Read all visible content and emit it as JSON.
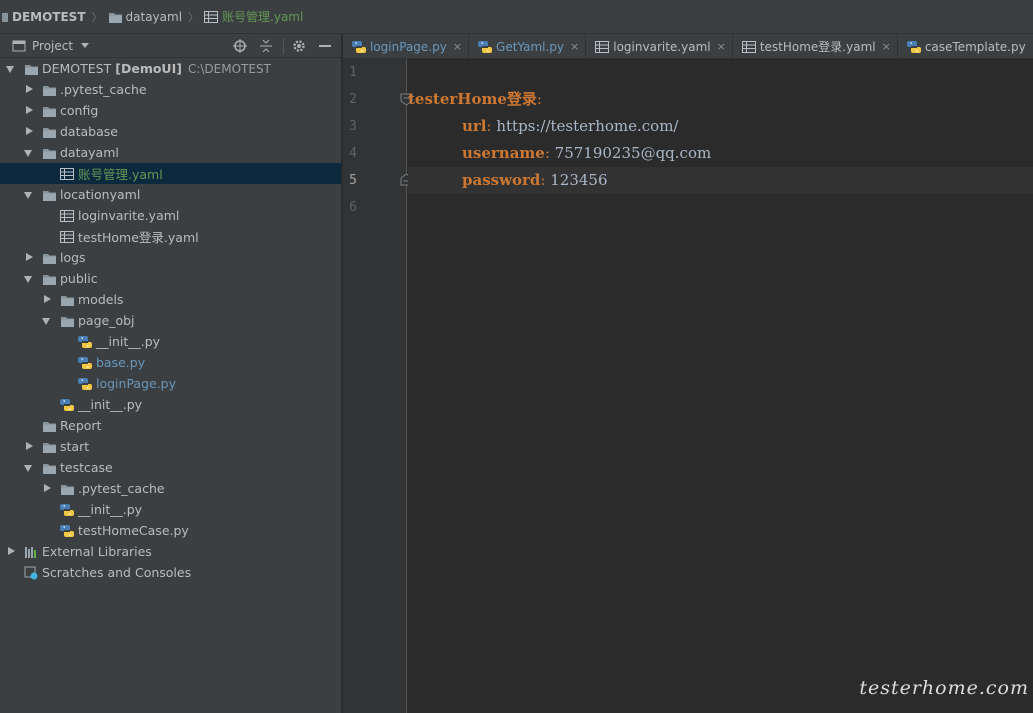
{
  "breadcrumb": {
    "project": "DEMOTEST",
    "folder": "datayaml",
    "file": "账号管理.yaml"
  },
  "project_panel": {
    "view_label": "Project",
    "tools": [
      "locate-icon",
      "collapse-icon",
      "gear-icon",
      "hide-icon"
    ]
  },
  "tree": {
    "root_name": "DEMOTEST",
    "root_module": "[DemoUI]",
    "root_path": "C:\\DEMOTEST",
    "pytest_cache": ".pytest_cache",
    "config": "config",
    "database": "database",
    "datayaml": "datayaml",
    "account_yaml": "账号管理.yaml",
    "locationyaml": "locationyaml",
    "loginvarite_yaml": "loginvarite.yaml",
    "testhome_yaml": "testHome登录.yaml",
    "logs": "logs",
    "public": "public",
    "models": "models",
    "page_obj": "page_obj",
    "init_py_1": "__init__.py",
    "base_py": "base.py",
    "loginpage_py": "loginPage.py",
    "init_py_2": "__init__.py",
    "report": "Report",
    "start": "start",
    "testcase": "testcase",
    "pytest_cache_2": ".pytest_cache",
    "init_py_3": "__init__.py",
    "testhomecase_py": "testHomeCase.py",
    "external_libraries": "External Libraries",
    "scratches": "Scratches and Consoles"
  },
  "tabs": [
    {
      "label": "loginPage.py",
      "close": "×"
    },
    {
      "label": "GetYaml.py",
      "close": "×"
    },
    {
      "label": "loginvarite.yaml",
      "close": "×"
    },
    {
      "label": "testHome登录.yaml",
      "close": "×"
    },
    {
      "label": "caseTemplate.py",
      "close": "×"
    }
  ],
  "editor": {
    "line_numbers": [
      "1",
      "2",
      "3",
      "4",
      "5",
      "6"
    ],
    "current_line": 5,
    "lines": {
      "l2_key": "testerHome登录",
      "l2_colon": ":",
      "l3_key": "url",
      "l3_colon": ":",
      "l3_val": " https://testerhome.com/",
      "l4_key": "username",
      "l4_colon": ":",
      "l4_val": " 757190235@qq.com",
      "l5_key": "password",
      "l5_colon": ":",
      "l5_val": " 123456"
    }
  },
  "watermark": "testerhome.com",
  "colors": {
    "yaml_key": "#cc7832",
    "value_text": "#a9b7c6",
    "selection": "#0d293e",
    "modified_file": "#6897bb",
    "new_file": "#629755"
  }
}
